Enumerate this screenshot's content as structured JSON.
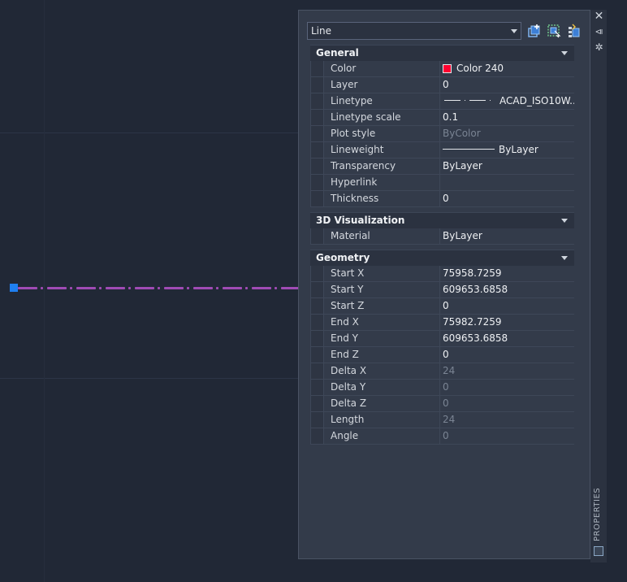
{
  "palette": {
    "side_label": "PROPERTIES",
    "selector": {
      "value": "Line"
    }
  },
  "categories": [
    {
      "title": "General",
      "rows": [
        {
          "name": "Color",
          "value": "Color 240",
          "readonly": false,
          "swatch": "#ff0030"
        },
        {
          "name": "Layer",
          "value": "0",
          "readonly": false
        },
        {
          "name": "Linetype",
          "value": "ACAD_ISO10W...",
          "readonly": false
        },
        {
          "name": "Linetype scale",
          "value": "0.1",
          "readonly": false
        },
        {
          "name": "Plot style",
          "value": "ByColor",
          "readonly": true
        },
        {
          "name": "Lineweight",
          "value": "ByLayer",
          "readonly": false
        },
        {
          "name": "Transparency",
          "value": "ByLayer",
          "readonly": false
        },
        {
          "name": "Hyperlink",
          "value": "",
          "readonly": false
        },
        {
          "name": "Thickness",
          "value": "0",
          "readonly": false
        }
      ]
    },
    {
      "title": "3D Visualization",
      "rows": [
        {
          "name": "Material",
          "value": "ByLayer",
          "readonly": false
        }
      ]
    },
    {
      "title": "Geometry",
      "rows": [
        {
          "name": "Start X",
          "value": "75958.7259",
          "readonly": false
        },
        {
          "name": "Start Y",
          "value": "609653.6858",
          "readonly": false
        },
        {
          "name": "Start Z",
          "value": "0",
          "readonly": false
        },
        {
          "name": "End X",
          "value": "75982.7259",
          "readonly": false
        },
        {
          "name": "End Y",
          "value": "609653.6858",
          "readonly": false
        },
        {
          "name": "End Z",
          "value": "0",
          "readonly": false
        },
        {
          "name": "Delta X",
          "value": "24",
          "readonly": true
        },
        {
          "name": "Delta Y",
          "value": "0",
          "readonly": true
        },
        {
          "name": "Delta Z",
          "value": "0",
          "readonly": true
        },
        {
          "name": "Length",
          "value": "24",
          "readonly": true
        },
        {
          "name": "Angle",
          "value": "0",
          "readonly": true
        }
      ]
    }
  ],
  "colors": {
    "canvas": "#212836",
    "line": "#a04bb5",
    "grip": "#1f7ff0",
    "color_240": "#ff0030"
  },
  "icons": [
    "close-icon",
    "auto-hide-icon",
    "settings-icon",
    "quick-select-icon",
    "select-objects-icon",
    "toggle-pickadd-icon",
    "properties-icon"
  ]
}
